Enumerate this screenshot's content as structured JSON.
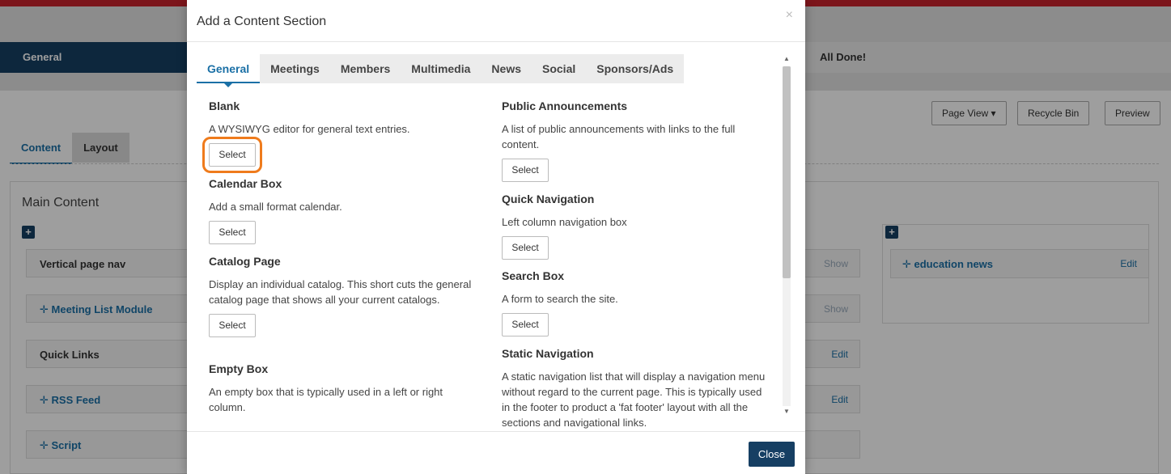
{
  "background": {
    "nav": {
      "general": "General",
      "all_done": "All Done!"
    },
    "toolbar": {
      "page_view": "Page View ▾",
      "recycle_bin": "Recycle Bin",
      "preview": "Preview"
    },
    "tabs": [
      "Content",
      "Layout"
    ],
    "main_title": "Main Content",
    "modules": [
      {
        "name": "Vertical page nav",
        "action": "Show",
        "link": false
      },
      {
        "name": "✛ Meeting List Module",
        "action": "Show",
        "link": true
      },
      {
        "name": "Quick Links",
        "action": "Edit",
        "link": false
      },
      {
        "name": "✛ RSS Feed",
        "action": "Edit",
        "link": true
      },
      {
        "name": "✛ Script",
        "action": "",
        "link": true
      }
    ],
    "right_module": {
      "name": "✛ education news",
      "action": "Edit"
    }
  },
  "modal": {
    "title": "Add a Content Section",
    "close_x": "×",
    "tabs": [
      "General",
      "Meetings",
      "Members",
      "Multimedia",
      "News",
      "Social",
      "Sponsors/Ads"
    ],
    "active_tab": "General",
    "select_label": "Select",
    "left_sections": [
      {
        "title": "Blank",
        "desc": "A WYSIWYG editor for general text entries."
      },
      {
        "title": "Calendar Box",
        "desc": "Add a small format calendar."
      },
      {
        "title": "Catalog Page",
        "desc": "Display an individual catalog. This short cuts the general catalog page that shows all your current catalogs."
      },
      {
        "title": "Empty Box",
        "desc": "An empty box that is typically used in a left or right column."
      }
    ],
    "right_sections": [
      {
        "title": "Public Announcements",
        "desc": "A list of public announcements with links to the full content."
      },
      {
        "title": "Quick Navigation",
        "desc": "Left column navigation box"
      },
      {
        "title": "Search Box",
        "desc": "A form to search the site."
      },
      {
        "title": "Static Navigation",
        "desc": "A static navigation list that will display a navigation menu without regard to the current page. This is typically used in the footer to product a 'fat footer' layout with all the sections and navigational links."
      }
    ],
    "close_label": "Close"
  }
}
